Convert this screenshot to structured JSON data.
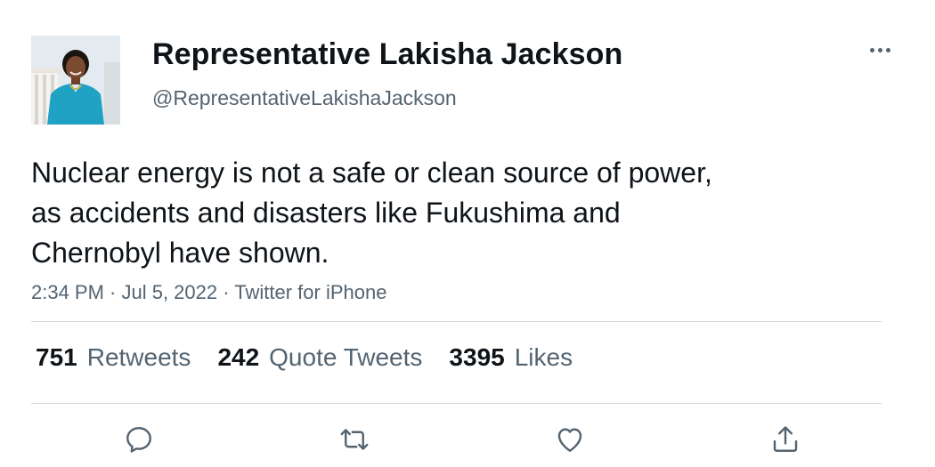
{
  "user": {
    "display_name": "Representative Lakisha Jackson",
    "handle": "@RepresentativeLakishaJackson"
  },
  "tweet": {
    "lines": [
      "Nuclear energy is not a safe or clean source of power,",
      "as accidents and disasters like Fukushima and",
      "Chernobyl have shown."
    ],
    "meta": "2:34 PM · Jul 5, 2022 · Twitter for iPhone"
  },
  "stats": {
    "retweets_count": "751",
    "retweets_label": "Retweets",
    "quotes_count": "242",
    "quotes_label": "Quote Tweets",
    "likes_count": "3395",
    "likes_label": "Likes"
  },
  "icons": {
    "more": "more-horizontal-icon",
    "reply": "reply-icon",
    "retweet": "retweet-icon",
    "like": "heart-icon",
    "share": "share-icon"
  },
  "colors": {
    "text_primary": "#0f1419",
    "text_secondary": "#536471",
    "divider": "#cfd9de",
    "avatar_jacket": "#1fa2c4"
  }
}
